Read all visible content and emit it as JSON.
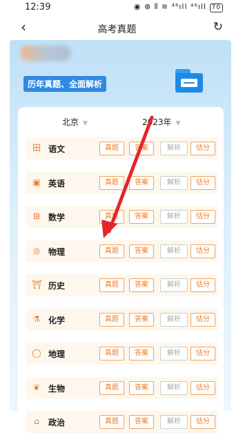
{
  "status_bar": {
    "time": "12:39",
    "icons": "◉ ⊗ ⫴ ≋ ⁴⁶ıll ⁴⁶ıll",
    "battery": "70"
  },
  "nav": {
    "back_icon": "‹",
    "title": "高考真题",
    "refresh_icon": "↻"
  },
  "hero": {
    "tagline": "历年真题、全面解析"
  },
  "filters": {
    "region": "北京",
    "year": "2023年"
  },
  "buttons": {
    "zhenti": "真题",
    "daan": "答案",
    "jiexi": "解析",
    "gufen": "估分"
  },
  "subjects": [
    {
      "name": "语文",
      "icon": "田"
    },
    {
      "name": "英语",
      "icon": "▣"
    },
    {
      "name": "数学",
      "icon": "⊞"
    },
    {
      "name": "物理",
      "icon": "◎"
    },
    {
      "name": "历史",
      "icon": "⛩"
    },
    {
      "name": "化学",
      "icon": "⚗"
    },
    {
      "name": "地理",
      "icon": "◯"
    },
    {
      "name": "生物",
      "icon": "❦"
    },
    {
      "name": "政治",
      "icon": "⌂"
    }
  ],
  "annotation_color": "#e3262b"
}
